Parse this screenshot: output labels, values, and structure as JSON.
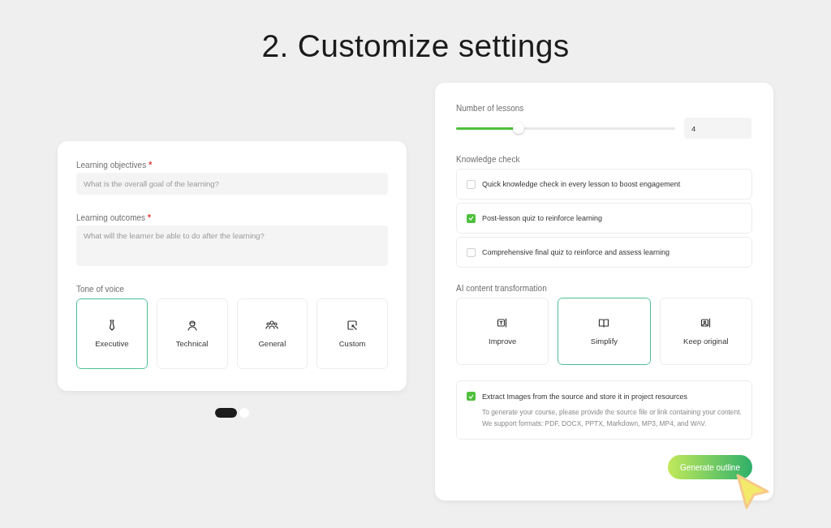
{
  "title": "2. Customize settings",
  "left_card": {
    "objectives": {
      "label": "Learning objectives",
      "required_mark": "*",
      "placeholder": "What is the overall goal of the learning?"
    },
    "outcomes": {
      "label": "Learning outcomes",
      "required_mark": "*",
      "placeholder": "What will the learner be able to do after the learning?"
    },
    "tone": {
      "label": "Tone of voice",
      "options": [
        {
          "label": "Executive",
          "selected": true
        },
        {
          "label": "Technical",
          "selected": false
        },
        {
          "label": "General",
          "selected": false
        },
        {
          "label": "Custom",
          "selected": false
        }
      ]
    }
  },
  "pagination": [
    {
      "selected": true
    },
    {
      "selected": false
    }
  ],
  "right_card": {
    "lessons": {
      "label": "Number of lessons",
      "level": 0.285,
      "value": "4"
    },
    "knowledge_check": {
      "label": "Knowledge check",
      "options": [
        {
          "label": "Quick knowledge check in every lesson to boost engagement",
          "checked": false
        },
        {
          "label": "Post-lesson quiz to reinforce learning",
          "checked": true
        },
        {
          "label": "Comprehensive final quiz to reinforce and assess learning",
          "checked": false
        }
      ]
    },
    "transformation": {
      "label": "AI content transformation",
      "options": [
        {
          "label": "Improve",
          "selected": false
        },
        {
          "label": "Simplify",
          "selected": true
        },
        {
          "label": "Keep original",
          "selected": false
        }
      ]
    },
    "extract": {
      "checked": true,
      "label": "Extract Images from the source and store it in project resources",
      "description": "To generate your course, please provide the source file or link containing your content. We support formats: PDF, DOCX, PPTX, Markdown, MP3, MP4, and WAV."
    },
    "button": "Generate outline"
  }
}
